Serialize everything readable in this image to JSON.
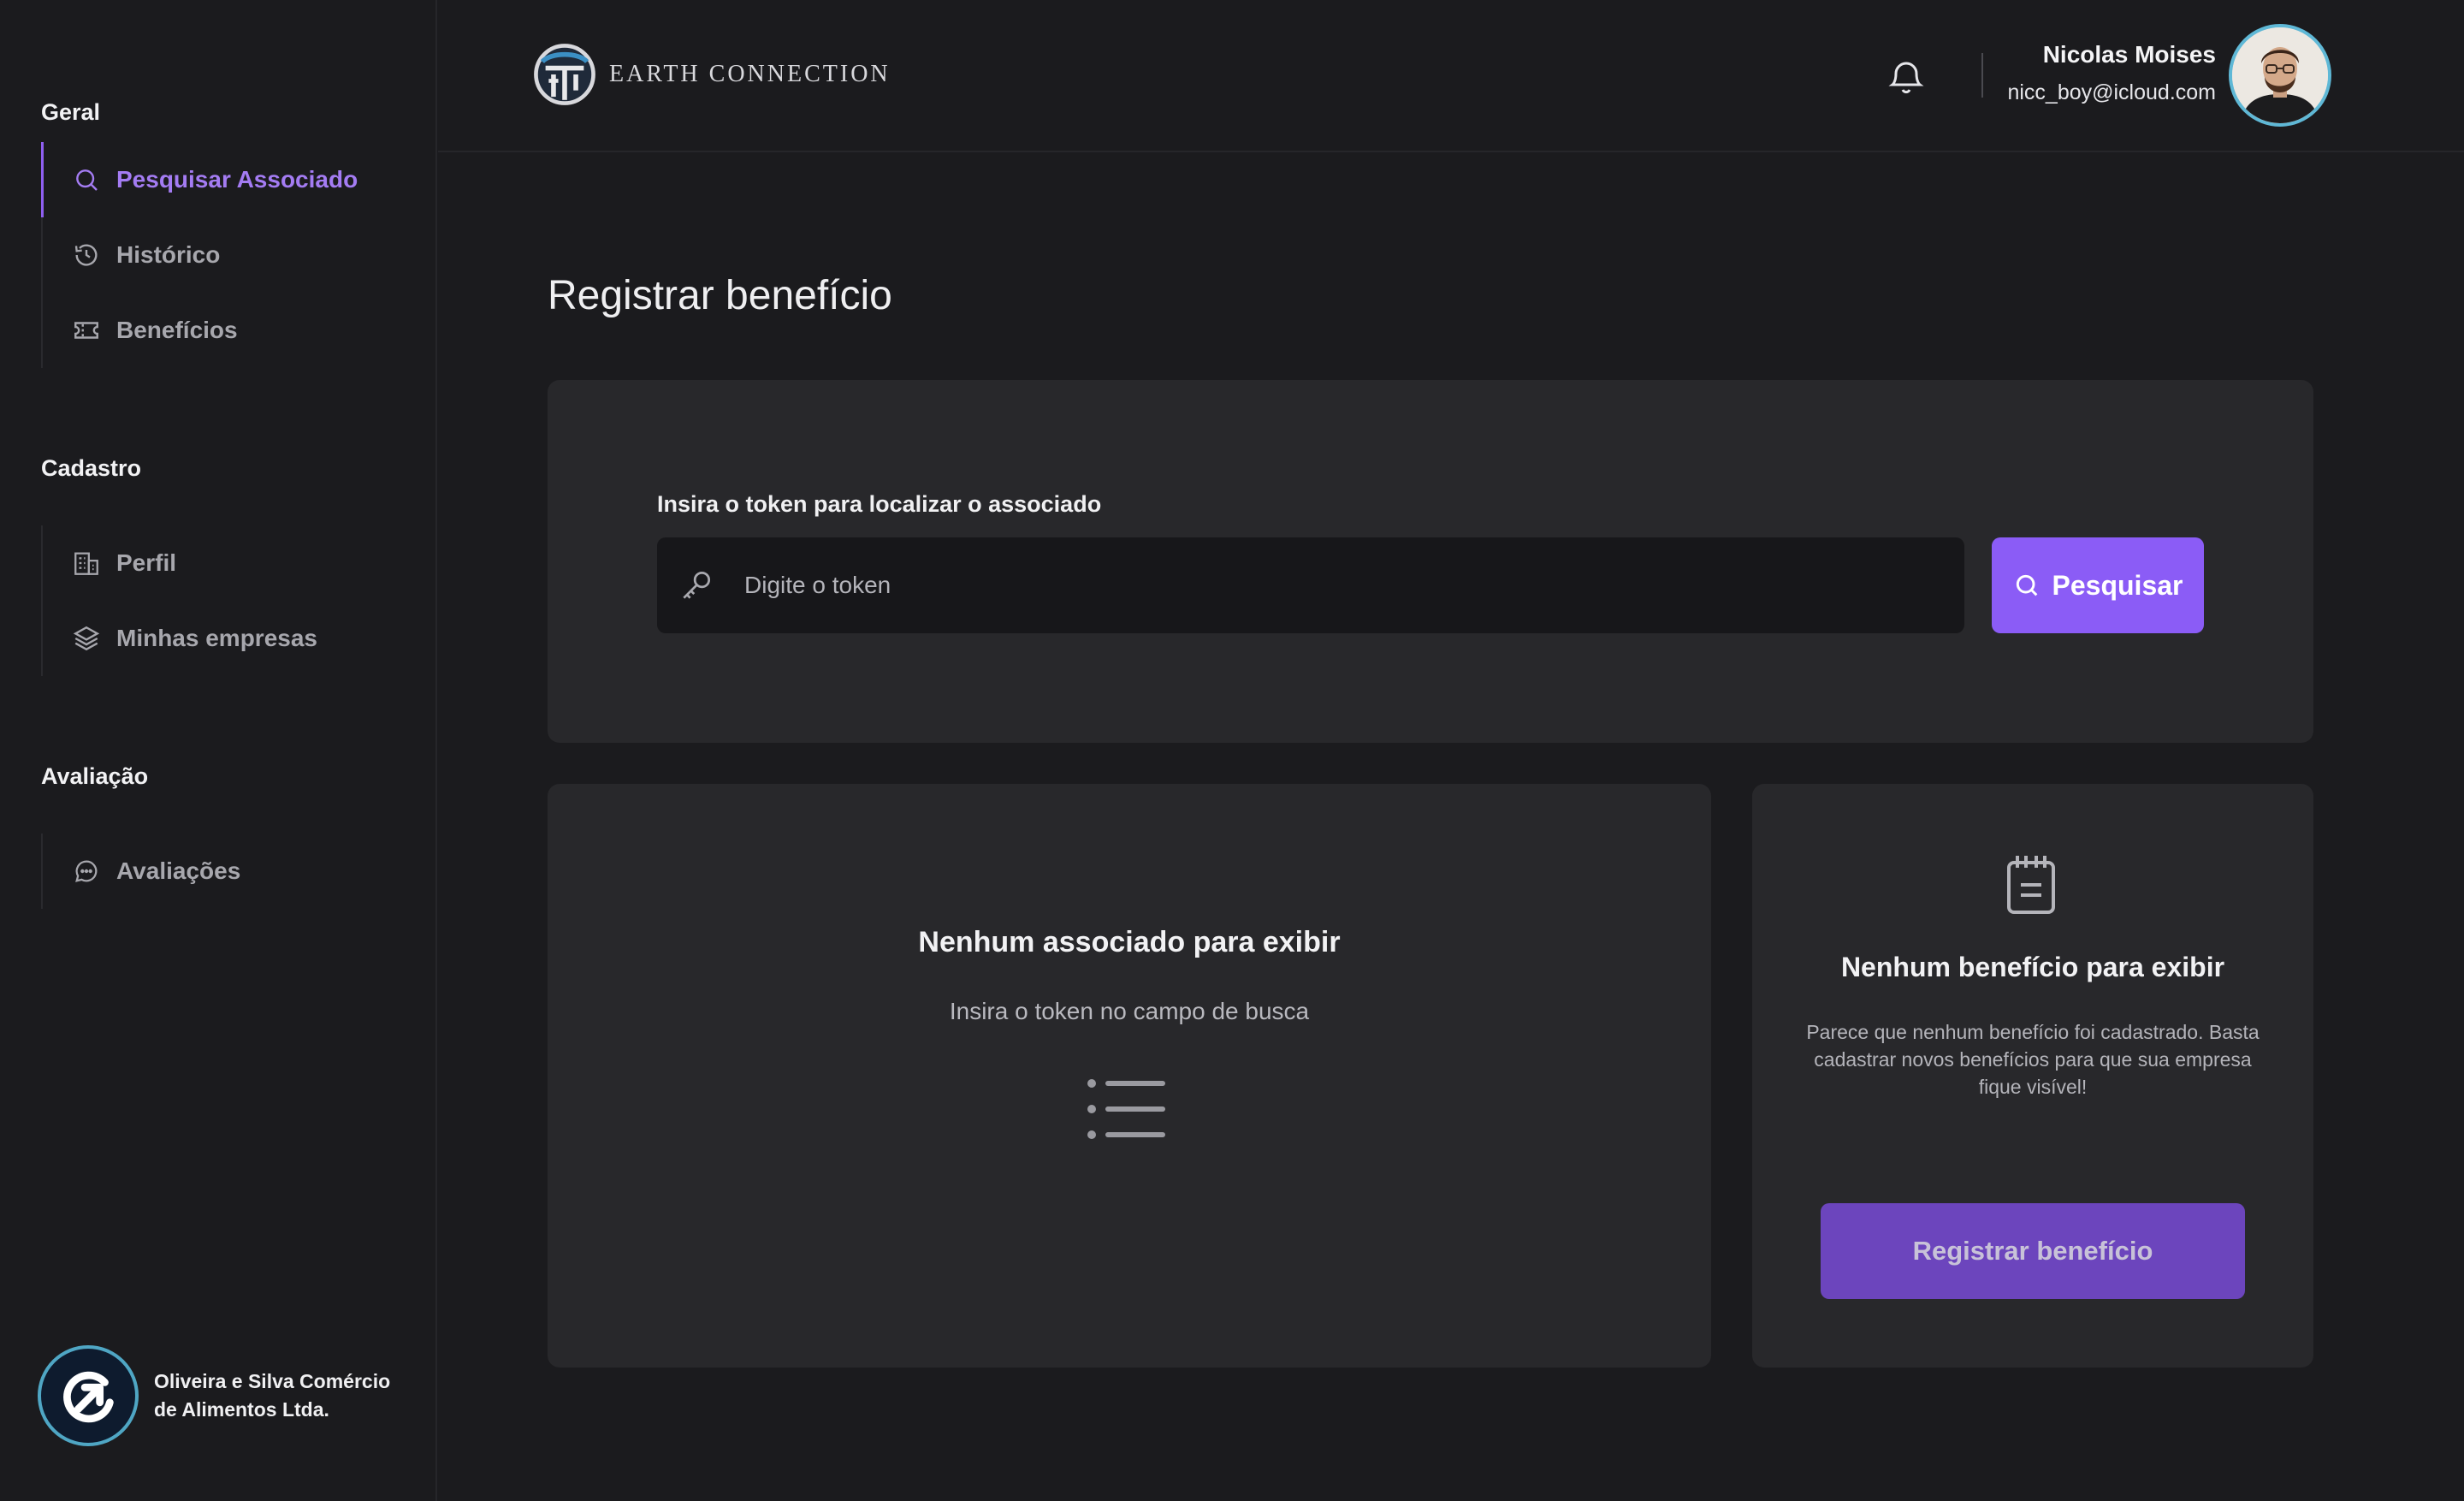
{
  "brand": {
    "name": "EARTH CONNECTION"
  },
  "sidebar": {
    "sections": [
      {
        "title": "Geral",
        "items": [
          {
            "label": "Pesquisar Associado",
            "icon": "search-icon",
            "active": true
          },
          {
            "label": "Histórico",
            "icon": "history-icon",
            "active": false
          },
          {
            "label": "Benefícios",
            "icon": "ticket-icon",
            "active": false
          }
        ]
      },
      {
        "title": "Cadastro",
        "items": [
          {
            "label": "Perfil",
            "icon": "building-icon",
            "active": false
          },
          {
            "label": "Minhas empresas",
            "icon": "layers-icon",
            "active": false
          }
        ]
      },
      {
        "title": "Avaliação",
        "items": [
          {
            "label": "Avaliações",
            "icon": "chat-icon",
            "active": false
          }
        ]
      }
    ],
    "company": {
      "name": "Oliveira e Silva Comércio de Alimentos Ltda."
    }
  },
  "header": {
    "user_name": "Nicolas Moises",
    "user_email": "nicc_boy@icloud.com"
  },
  "main": {
    "title": "Registrar benefício",
    "search": {
      "label": "Insira o token para localizar o associado",
      "placeholder": "Digite o token",
      "value": "",
      "button_label": "Pesquisar"
    },
    "associates_empty": {
      "title": "Nenhum associado para exibir",
      "subtitle": "Insira o token no campo de busca"
    },
    "benefits_empty": {
      "title": "Nenhum benefício para exibir",
      "description": "Parece que nenhum benefício foi cadastrado. Basta cadastrar novos benefícios para que sua empresa fique visível!",
      "button_label": "Registrar benefício"
    }
  },
  "colors": {
    "accent": "#8b5cf6",
    "accent_dark": "#6c45bd",
    "active_nav": "#a47cf3",
    "background": "#1b1b1e",
    "card": "#28282b"
  }
}
